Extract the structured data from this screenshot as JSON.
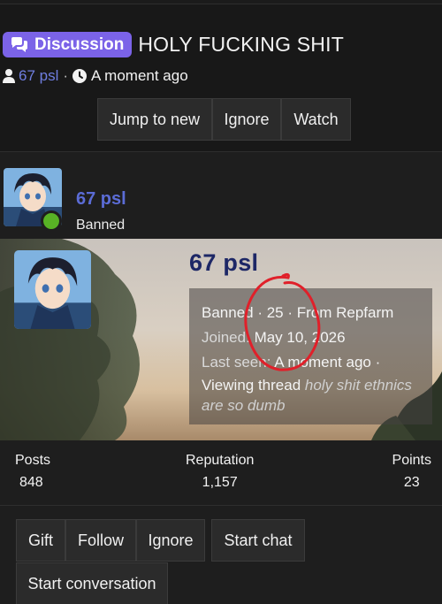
{
  "thread": {
    "prefix": "Discussion",
    "title": "HOLY FUCKING SHIT",
    "author": "67 psl",
    "separator": "·",
    "time": "A moment ago",
    "buttons": {
      "jump": "Jump to new",
      "ignore": "Ignore",
      "watch": "Watch"
    }
  },
  "post": {
    "username": "67 psl",
    "role": "Banned"
  },
  "profile_banner": {
    "username": "67 psl",
    "line1": "Banned · 25 · From Repfarm",
    "joined_label": "Joined:",
    "joined_value": "May 10, 2026",
    "last_seen_label": "Last seen:",
    "last_seen_value": "A moment ago ·",
    "activity_prefix": "Viewing thread",
    "activity_thread": "holy shit ethnics are so dumb"
  },
  "stats": {
    "posts_label": "Posts",
    "posts_value": "848",
    "reputation_label": "Reputation",
    "reputation_value": "1,157",
    "points_label": "Points",
    "points_value": "23"
  },
  "member_buttons": {
    "gift": "Gift",
    "follow": "Follow",
    "ignore": "Ignore",
    "start_chat": "Start chat",
    "start_conversation": "Start conversation"
  },
  "colors": {
    "prefix_bg": "#7b63e8",
    "username_link": "#5b6cd6",
    "online": "#58b225",
    "annotation": "#e0202a"
  },
  "icons": [
    "chat-bubbles-icon",
    "user-icon",
    "clock-icon"
  ]
}
